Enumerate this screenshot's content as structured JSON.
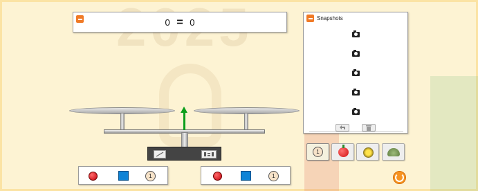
{
  "equation": {
    "left": "0",
    "operator": "=",
    "right": "0"
  },
  "snapshots": {
    "title": "Snapshots",
    "slots": [
      "camera-icon",
      "camera-icon",
      "camera-icon",
      "camera-icon",
      "camera-icon"
    ],
    "toolbar": [
      "undo-icon",
      "trash-icon"
    ]
  },
  "left_toolbox": {
    "items": [
      "red-ball",
      "blue-box",
      "coin"
    ],
    "coin_label": "1"
  },
  "right_toolbox": {
    "items": [
      "red-ball",
      "blue-box",
      "coin"
    ],
    "coin_label": "1"
  },
  "lab_buttons": {
    "coin_label": "1",
    "icons": [
      "coin-icon",
      "apple-icon",
      "yellow-disc-icon",
      "turtle-icon"
    ]
  },
  "watermark": {
    "year": "2025"
  },
  "colors": {
    "accent": "#f07a26",
    "arrow": "#0b9e1b",
    "red_ball": "#c4000c",
    "blue_box": "#0f83d6",
    "background": "#fdf3d3"
  }
}
